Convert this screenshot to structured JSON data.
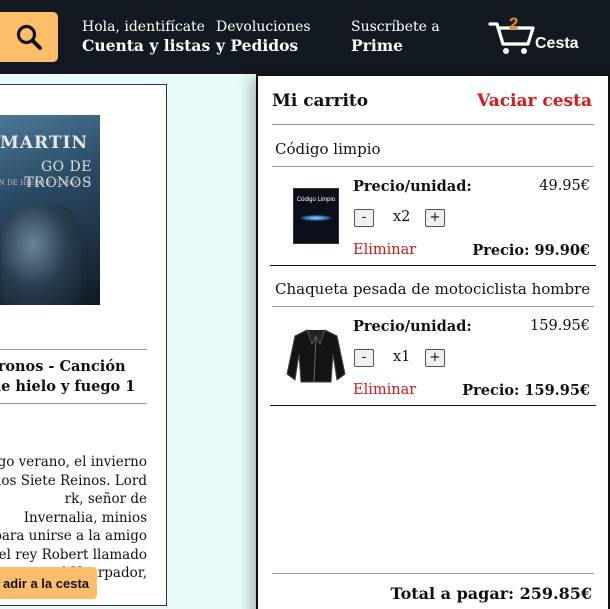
{
  "nav": {
    "account_small": "Hola, identifícate",
    "account_big": "Cuenta y listas",
    "returns_small": "Devoluciones",
    "returns_big": "y Pedidos",
    "prime_small": "Suscríbete a",
    "prime_big": "Prime",
    "cart_count": "2",
    "cart_label": "Cesta"
  },
  "product": {
    "cover_author": "MARTIN",
    "cover_title": "GO DE TRONOS",
    "cover_subtitle": "ÓN DE HIELO Y FUEGO / 1",
    "title": "tronos - Canción de hielo y fuego 1",
    "description": "go verano, el invierno los Siete Reinos. Lord rk, señor de Invernalia, minios para unirse a la amigo el rey Robert llamado el Usurpador,",
    "add_button": "adir a la cesta"
  },
  "cart": {
    "title": "Mi carrito",
    "clear": "Vaciar cesta",
    "unit_label": "Precio/unidad:",
    "remove_label": "Eliminar",
    "items": [
      {
        "name": "Código limpio",
        "thumb_text": "Código Limpio",
        "unit_price": "49.95€",
        "qty": "x2",
        "line_total": "Precio: 99.90€"
      },
      {
        "name": "Chaqueta pesada de motociclista hombre",
        "unit_price": "159.95€",
        "qty": "x1",
        "line_total": "Precio: 159.95€"
      }
    ],
    "total": "Total a pagar: 259.85€"
  },
  "colors": {
    "nav_bg": "#131921",
    "accent": "#febd69",
    "cart_count": "#f08804",
    "danger": "#e01515"
  }
}
